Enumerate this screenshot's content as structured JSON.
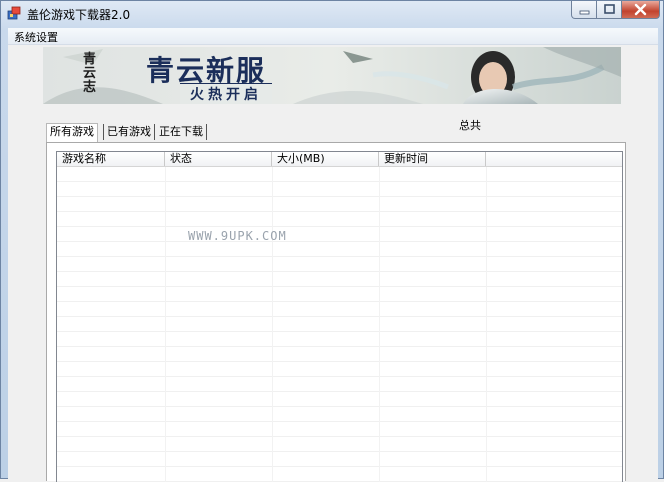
{
  "window": {
    "title": "盖伦游戏下载器2.0",
    "icon": "app-icon"
  },
  "menu": {
    "items": [
      {
        "label": "系统设置"
      }
    ]
  },
  "banner": {
    "logo_text": "青云志",
    "headline": "青云新服",
    "subline": "火热开启"
  },
  "summary": {
    "total_label": "总共"
  },
  "tabs": [
    {
      "label": "所有游戏",
      "selected": true
    },
    {
      "label": "已有游戏",
      "selected": false
    },
    {
      "label": "正在下载",
      "selected": false
    }
  ],
  "table": {
    "columns": [
      "游戏名称",
      "状态",
      "大小(MB)",
      "更新时间",
      ""
    ],
    "rows": []
  },
  "watermark": "WWW.9UPK.COM",
  "colors": {
    "title_gradient_top": "#dfe9f5",
    "close_button": "#c2432e",
    "banner_text": "#1b2e5a"
  }
}
